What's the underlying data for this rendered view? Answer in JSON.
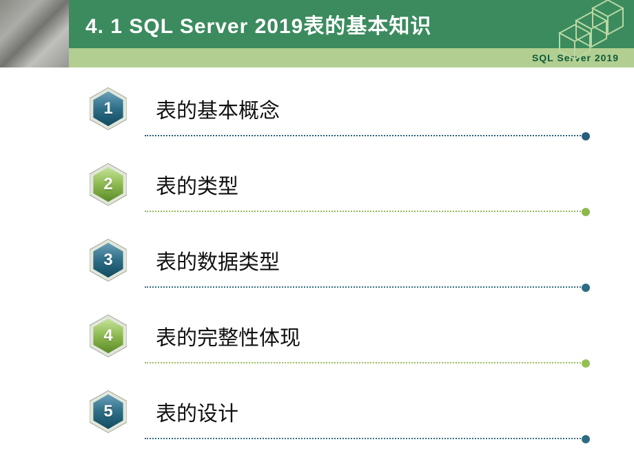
{
  "header": {
    "title": "4. 1  SQL Server 2019表的基本知识",
    "subtitle": "SQL  Server 2019"
  },
  "items": [
    {
      "num": "1",
      "label": "表的基本概念",
      "color": "blue"
    },
    {
      "num": "2",
      "label": "表的类型",
      "color": "green"
    },
    {
      "num": "3",
      "label": "表的数据类型",
      "color": "blue"
    },
    {
      "num": "4",
      "label": "表的完整性体现",
      "color": "green"
    },
    {
      "num": "5",
      "label": "表的设计",
      "color": "blue"
    }
  ],
  "palette": {
    "blue_top": "#6aa0b8",
    "blue_mid": "#2e6e87",
    "blue_bot": "#114b60",
    "green_top": "#c6e39b",
    "green_mid": "#8cb94f",
    "green_bot": "#5c8a2a",
    "outer": "#e2e6db"
  }
}
